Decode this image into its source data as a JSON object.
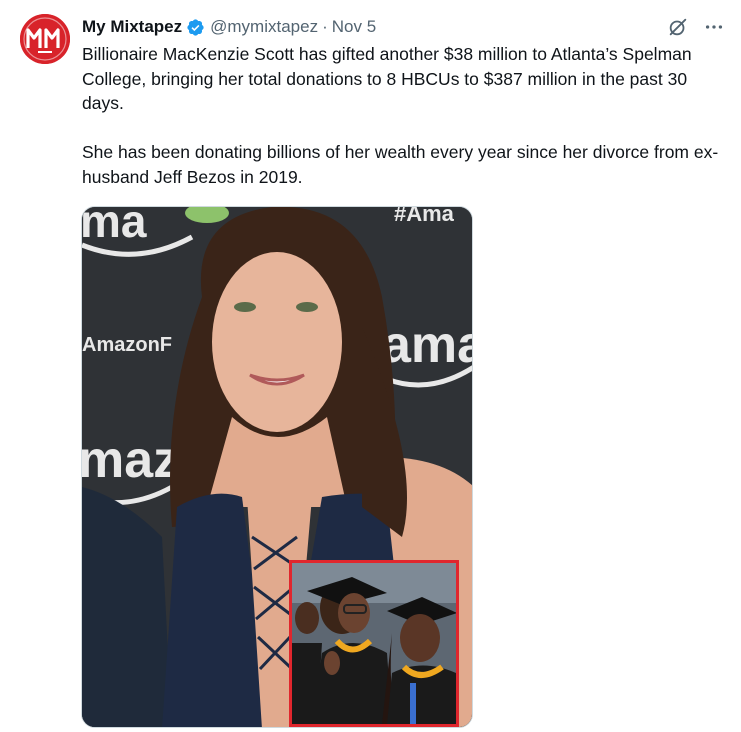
{
  "tweet": {
    "display_name": "My Mixtapez",
    "handle": "@mymixtapez",
    "separator": "·",
    "date": "Nov 5",
    "paragraphs": [
      "Billionaire MacKenzie Scott has gifted another $38 million to Atlanta’s Spelman College, bringing her total donations to 8 HBCUs to $387 million in the past 30 days.",
      "She has been donating billions of her wealth every year since her divorce from ex-husband Jeff Bezos in 2019."
    ]
  },
  "avatar": {
    "logo_text": "MM",
    "color": "#d8232a"
  },
  "photo_backdrop_text": [
    "ma",
    "#Ama",
    "AmazonF",
    "ama",
    "maz"
  ],
  "icons": {
    "verified": "verified-badge-icon",
    "grok": "grok-icon",
    "more": "more-options-icon"
  },
  "colors": {
    "text": "#0f1419",
    "secondary": "#536471",
    "verified": "#1d9bf0",
    "inset_border": "#e0262d"
  }
}
